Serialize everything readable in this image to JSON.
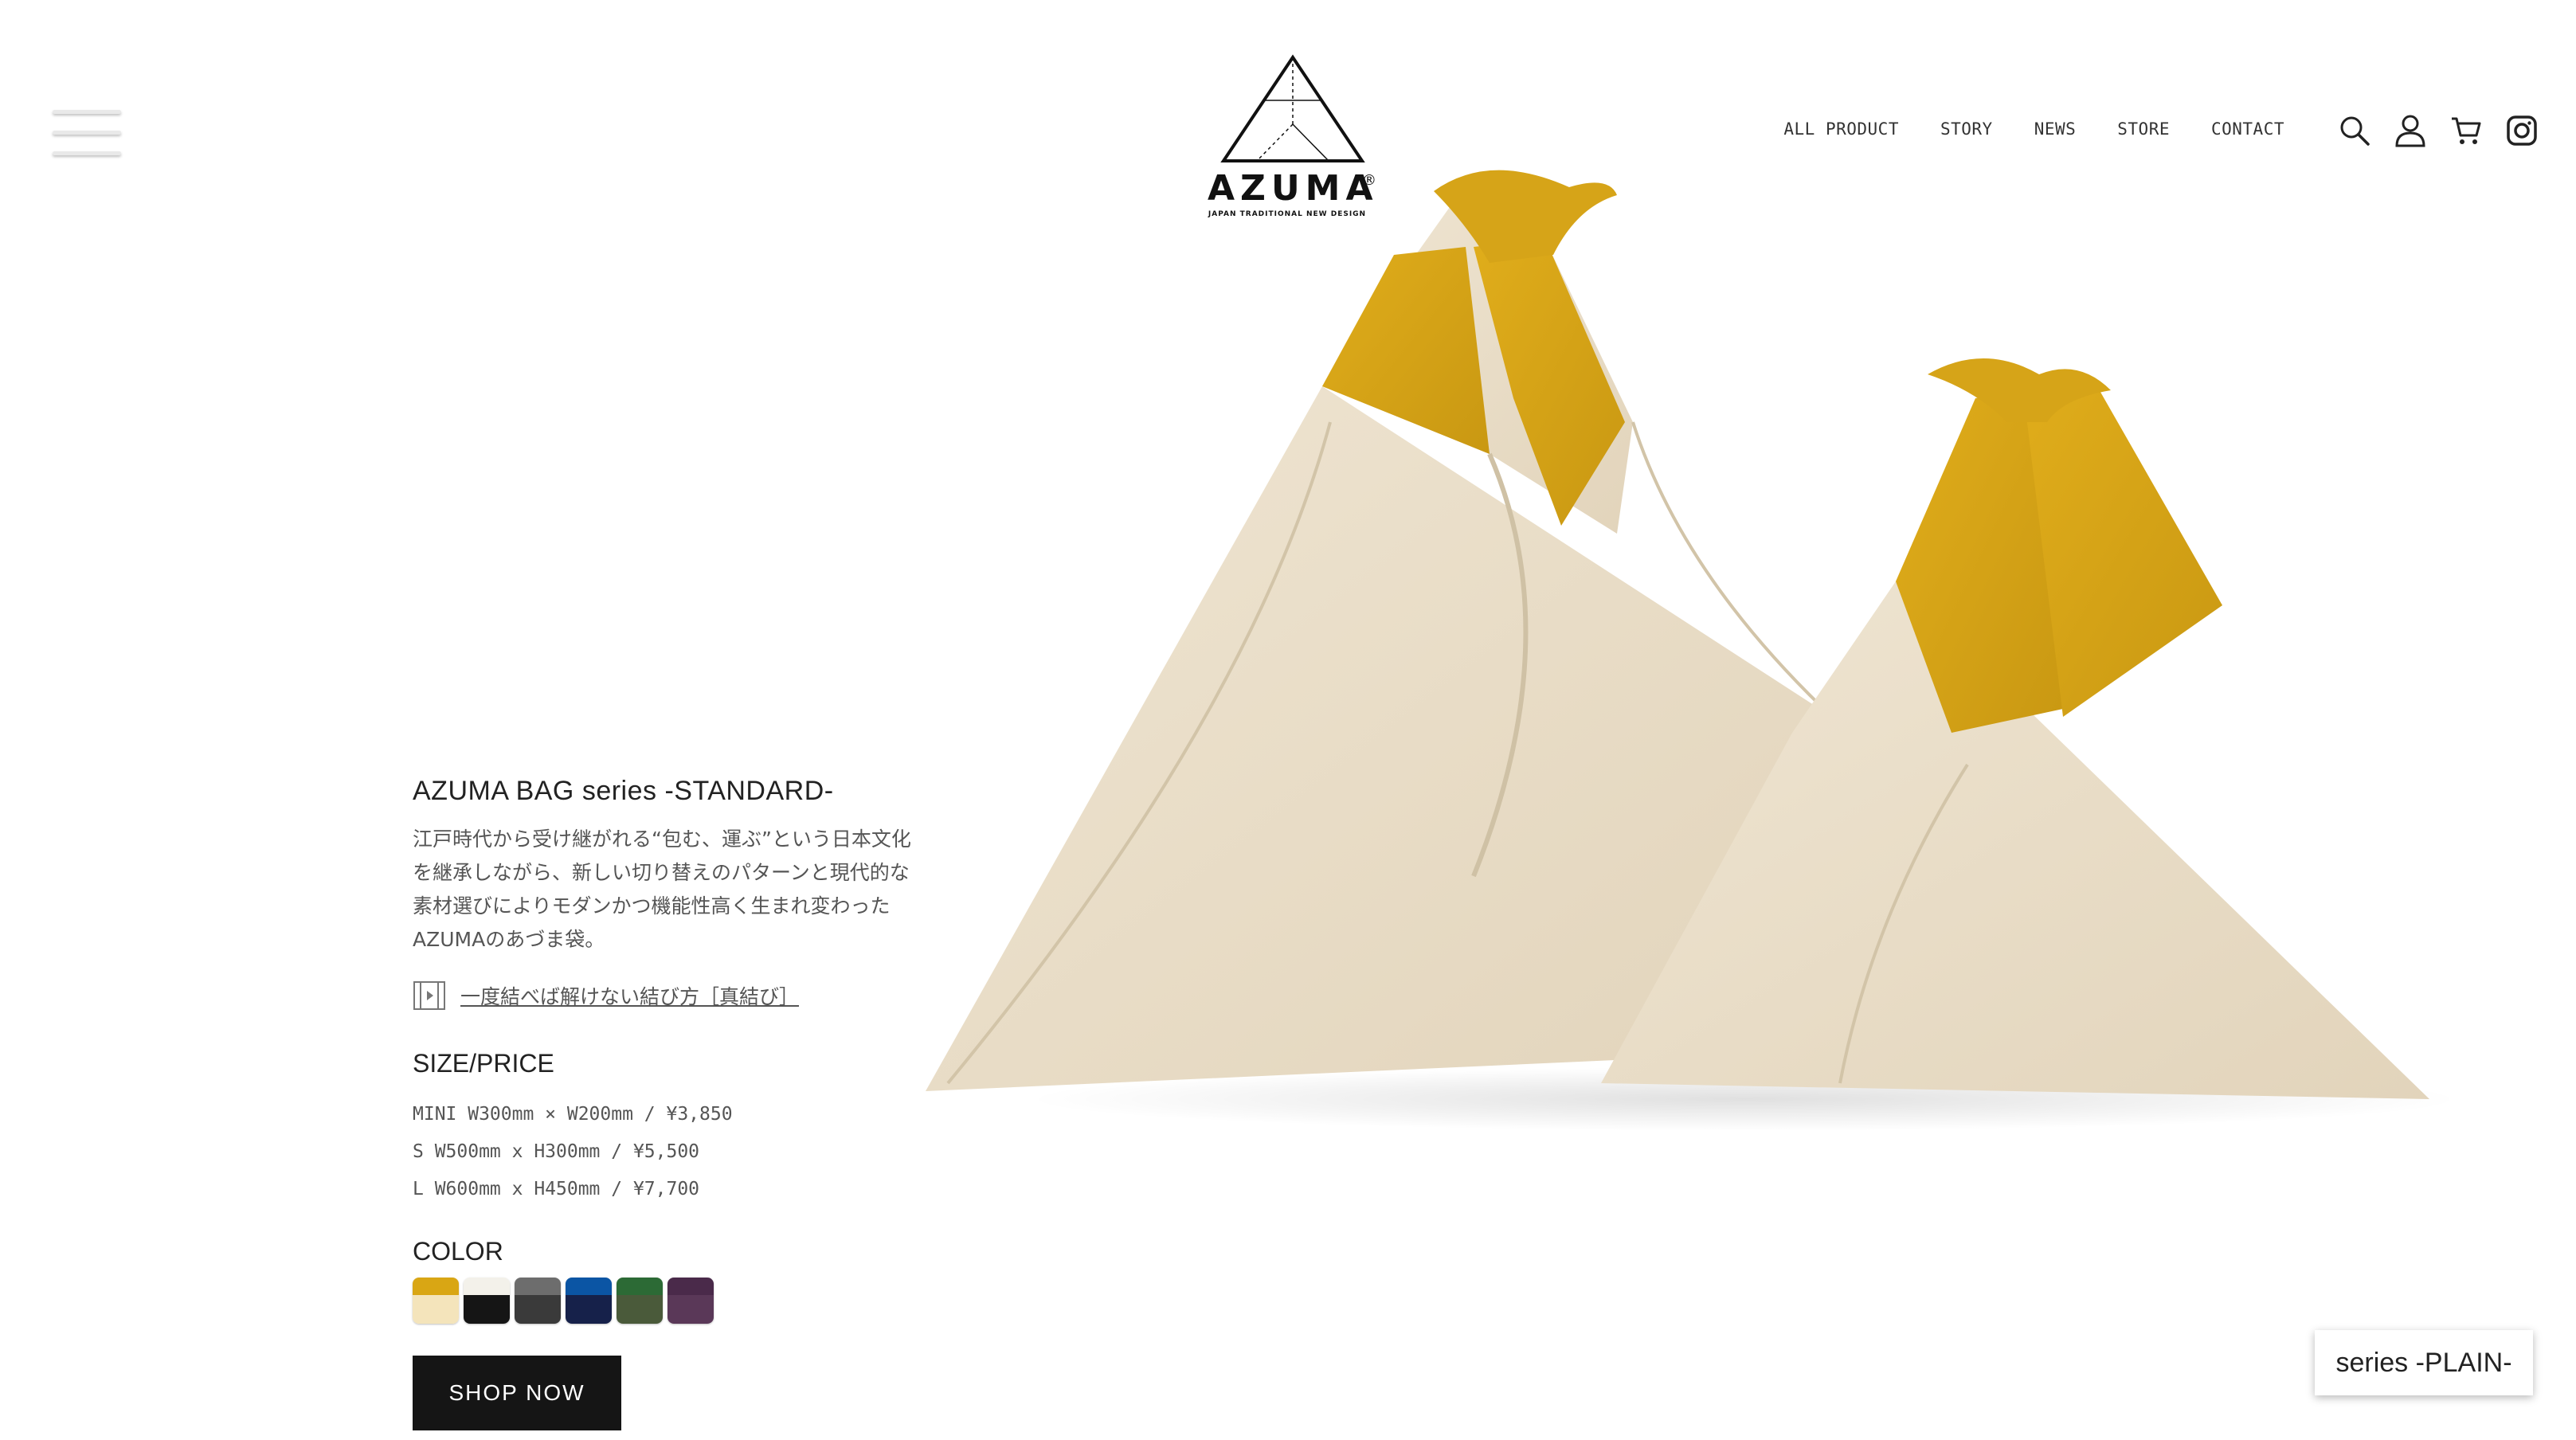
{
  "logo": {
    "wordmark": "AZUMA",
    "registered": "®",
    "tagline": "JAPAN TRADITIONAL NEW DESIGN"
  },
  "nav": {
    "items": [
      "ALL PRODUCT",
      "STORY",
      "NEWS",
      "STORE",
      "CONTACT"
    ],
    "icons": [
      "search-icon",
      "user-icon",
      "cart-icon",
      "instagram-icon"
    ]
  },
  "product": {
    "title": "AZUMA BAG series -STANDARD-",
    "description": "江戸時代から受け継がれる“包む、運ぶ”という日本文化を継承しながら、新しい切り替えのパターンと現代的な素材選びによりモダンかつ機能性高く生まれ変わったAZUMAのあづま袋。",
    "video_link": "一度結べば解けない結び方［真結び］",
    "size_heading": "SIZE/PRICE",
    "sizes": [
      "MINI W300mm × W200mm / ¥3,850",
      "S W500mm x H300mm / ¥5,500",
      "L W600mm x H450mm / ¥7,700"
    ],
    "color_heading": "COLOR",
    "colors": [
      {
        "top": "#d9a614",
        "bottom": "#f4e4bb"
      },
      {
        "top": "#f3f1ea",
        "bottom": "#151515"
      },
      {
        "top": "#6d6d6d",
        "bottom": "#3a3a3a"
      },
      {
        "top": "#0b55a4",
        "bottom": "#16214a"
      },
      {
        "top": "#2c6a35",
        "bottom": "#4a5a3a"
      },
      {
        "top": "#4a2a4a",
        "bottom": "#5a3858"
      }
    ],
    "shop_label": "SHOP NOW"
  },
  "side_tab": {
    "label": "series -PLAIN-"
  },
  "palette": {
    "mustard": "#d4a520",
    "beige": "#ece0cb",
    "black": "#151515"
  }
}
